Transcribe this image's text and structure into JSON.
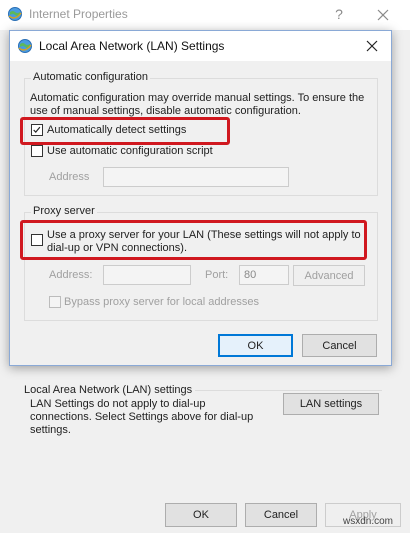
{
  "background_window": {
    "title": "Internet Properties",
    "help_glyph": "?",
    "lan_group": {
      "title": "Local Area Network (LAN) settings",
      "note": "LAN Settings do not apply to dial-up connections. Select Settings above for dial-up settings.",
      "button_label": "LAN settings"
    },
    "buttons": {
      "ok": "OK",
      "cancel": "Cancel",
      "apply": "Apply"
    }
  },
  "dialog": {
    "title": "Local Area Network (LAN) Settings",
    "auto_config": {
      "title": "Automatic configuration",
      "description": "Automatic configuration may override manual settings.  To ensure the use of manual settings, disable automatic configuration.",
      "auto_detect": {
        "label": "Automatically detect settings",
        "checked": true
      },
      "use_script": {
        "label": "Use automatic configuration script",
        "checked": false
      },
      "address_label": "Address",
      "address_value": ""
    },
    "proxy": {
      "title": "Proxy server",
      "use_proxy": {
        "label": "Use a proxy server for your LAN (These settings will not apply to dial-up or VPN connections).",
        "checked": false
      },
      "address_label": "Address:",
      "address_value": "",
      "port_label": "Port:",
      "port_value": "80",
      "advanced_label": "Advanced",
      "bypass": {
        "label": "Bypass proxy server for local addresses",
        "checked": false
      }
    },
    "buttons": {
      "ok": "OK",
      "cancel": "Cancel"
    }
  },
  "watermark": "wsxdn.com",
  "colors": {
    "highlight": "#d0181f",
    "accent": "#0078d7"
  },
  "icons": [
    "internet-globe-icon",
    "close-icon",
    "checkmark-icon"
  ]
}
